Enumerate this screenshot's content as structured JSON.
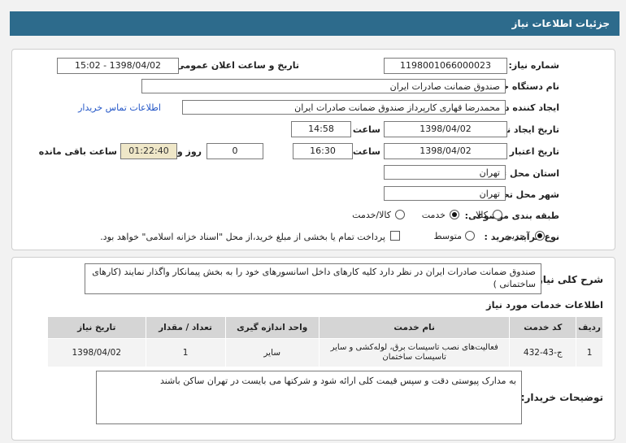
{
  "header": {
    "title": "جزئیات اطلاعات نیاز"
  },
  "form": {
    "need_number_label": "شماره نیاز:",
    "need_number": "1198001066000023",
    "announce_label": "تاریخ و ساعت اعلان عمومی:",
    "announce_value": "1398/04/02 - 15:02",
    "buyer_org_label": "نام دستگاه خریدار:",
    "buyer_org": "صندوق ضمانت صادرات ایران",
    "requester_label": "ایجاد کننده درخواست:",
    "requester": "محمدرضا قهاری کارپرداز صندوق ضمانت صادرات ایران",
    "contact_link": "اطلاعات تماس خریدار",
    "created_label": "تاریخ ایجاد نیاز:",
    "created_date": "1398/04/02",
    "time_label": "ساعت",
    "created_time": "14:58",
    "valid_label": "تاریخ اعتبار نیاز:",
    "valid_date": "1398/04/02",
    "valid_time": "16:30",
    "days": "0",
    "days_label": "روز و",
    "remaining": "01:22:40",
    "remaining_label": "ساعت باقی مانده",
    "province_label": "استان محل تحویل:",
    "province": "تهران",
    "city_label": "شهر محل تحویل:",
    "city": "تهران",
    "category_label": "طبقه بندی موضوعی:",
    "category_options": [
      "کالا",
      "خدمت",
      "کالا/خدمت"
    ],
    "category_selected": "خدمت",
    "process_label": "نوع فرآیند خرید :",
    "process_options": [
      "جزیی",
      "متوسط"
    ],
    "process_selected": "جزیی",
    "payment_note": "پرداخت تمام یا بخشی از مبلغ خرید،از محل \"اسناد خزانه اسلامی\" خواهد بود."
  },
  "summary": {
    "label": "شرح کلی نیاز:",
    "text": "صندوق ضمانت صادرات ایران در نظر دارد کلیه کارهای داخل اسانسورهای خود را به بخش پیمانکار واگذار نمایند (کارهای ساختمانی )"
  },
  "services": {
    "title": "اطلاعات خدمات مورد نیاز",
    "columns": [
      "ردیف",
      "کد خدمت",
      "نام خدمت",
      "واحد اندازه گیری",
      "تعداد / مقدار",
      "تاریخ نیاز"
    ],
    "rows": [
      [
        "1",
        "ج-43-432",
        "فعالیت‌های نصب تاسیسات برق، لوله‌کشی و سایر تاسیسات ساختمان",
        "سایر",
        "1",
        "1398/04/02"
      ]
    ]
  },
  "notes": {
    "label": "توضیحات خریدار:",
    "text": "به مدارک پیوستی دقت و سپس قیمت کلی ارائه شود و شرکتها می بایست در تهران ساکن باشند"
  }
}
